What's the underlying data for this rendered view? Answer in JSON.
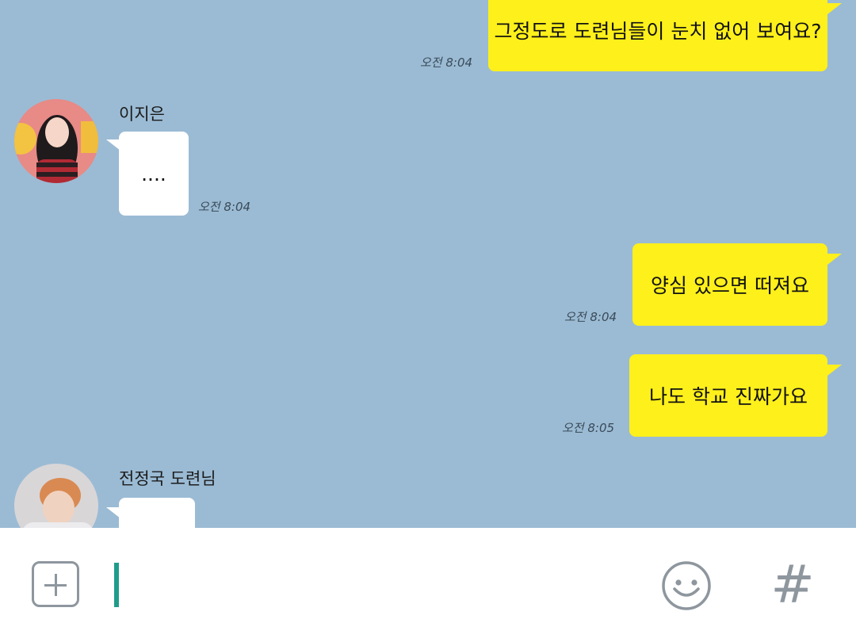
{
  "messages": [
    {
      "side": "me",
      "text": "그정도로 도련님들이 눈치 없어 보여요?",
      "time": "오전 8:04"
    },
    {
      "side": "other",
      "sender": "이지은",
      "text": "....",
      "time": "오전 8:04"
    },
    {
      "side": "me",
      "text": "양심 있으면 떠져요",
      "time": "오전 8:04"
    },
    {
      "side": "me",
      "text": "나도 학교 진짜가요",
      "time": "오전 8:05"
    },
    {
      "side": "other",
      "sender": "전정국 도련님",
      "text": "",
      "time": ""
    }
  ],
  "input": {
    "value": "",
    "placeholder": ""
  },
  "icons": {
    "attach": "plus-icon",
    "emoji": "emoji-icon",
    "hashtag": "hashtag-icon"
  },
  "colors": {
    "background": "#9bbbd4",
    "my_bubble": "#fef01b",
    "other_bubble": "#ffffff",
    "cursor": "#1f9c8a"
  }
}
